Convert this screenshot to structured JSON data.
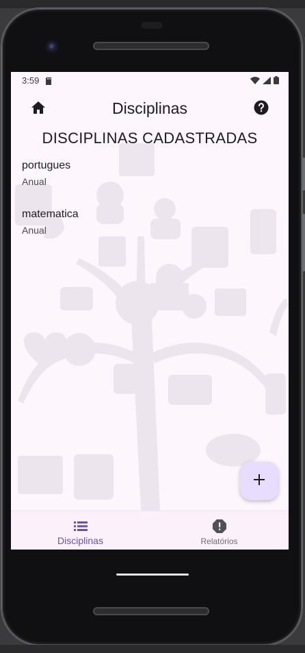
{
  "status_bar": {
    "time": "3:59",
    "icons": [
      "sd-card-icon",
      "wifi-icon",
      "signal-icon",
      "battery-icon"
    ]
  },
  "app_bar": {
    "title": "Disciplinas",
    "left_icon": "home-icon",
    "right_icon": "help-icon"
  },
  "main": {
    "heading": "DISCIPLINAS CADASTRADAS",
    "items": [
      {
        "name": "portugues",
        "period": "Anual"
      },
      {
        "name": "matematica",
        "period": "Anual"
      }
    ]
  },
  "fab": {
    "label": "+",
    "icon": "add-icon"
  },
  "bottom_nav": {
    "items": [
      {
        "label": "Disciplinas",
        "icon": "list-icon",
        "active": true
      },
      {
        "label": "Relatórios",
        "icon": "report-icon",
        "active": false
      }
    ]
  },
  "colors": {
    "screen_bg": "#fdf6fd",
    "accent": "#6a4fa8",
    "fab_bg": "#e9ddff",
    "text_primary": "#1d1b20"
  }
}
